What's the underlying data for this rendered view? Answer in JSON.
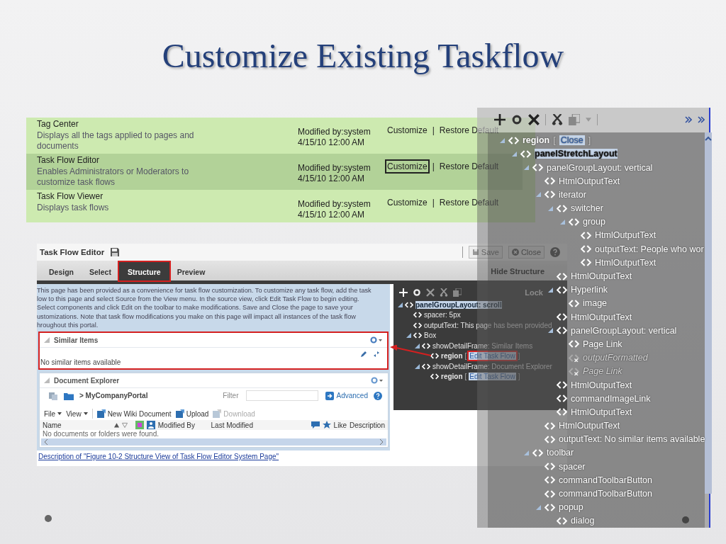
{
  "slide_title": "Customize Existing Taskflow",
  "taskflows": [
    {
      "name": "Tag Center",
      "description": "Displays all the tags applied to pages and documents",
      "modified_by": "Modified by:system",
      "modified": "4/15/10 12:00 AM",
      "customize": "Customize",
      "separator": "|",
      "restore": "Restore Default",
      "selected": false
    },
    {
      "name": "Task Flow Editor",
      "description": "Enables Administrators or Moderators to customize task flows",
      "modified_by": "Modified by:system",
      "modified": "4/15/10 12:00 AM",
      "customize": "Customize",
      "separator": "|",
      "restore": "Restore Default",
      "selected": true
    },
    {
      "name": "Task Flow Viewer",
      "description": "Displays task flows",
      "modified_by": "Modified by:system",
      "modified": "4/15/10 12:00 AM",
      "customize": "Customize",
      "separator": "|",
      "restore": "Restore Default",
      "selected": false
    }
  ],
  "editor": {
    "title": "Task Flow Editor",
    "save": "Save",
    "close": "Close",
    "tabs": [
      {
        "label": "Design",
        "selected": false
      },
      {
        "label": "Select",
        "selected": false
      },
      {
        "label": "Structure",
        "selected": true
      },
      {
        "label": "Preview",
        "selected": false
      }
    ],
    "hide_structure": "Hide Structure",
    "lock": "Lock",
    "info_lines": [
      "This page has been provided as a convenience for task flow customization. To customize any task flow, add the task",
      "low to this page and select Source from the View menu. In the source view, click Edit Task Flow to begin editing.",
      "Select components and click Edit on the toolbar to make modifications. Save and Close the page to save your",
      "ustomizations. Note that task flow modifications you make on this page will impact all instances of the task flow",
      "hroughout this portal."
    ],
    "similar_items": {
      "title": "Similar Items",
      "empty": "No similar items available"
    },
    "document_explorer": {
      "title": "Document Explorer",
      "path": "> MyCompanyPortal",
      "filter_label": "Filter",
      "advanced": "Advanced",
      "menus": [
        "File",
        "View"
      ],
      "actions": [
        {
          "label": "New Wiki Document",
          "disabled": false
        },
        {
          "label": "Upload",
          "disabled": false
        },
        {
          "label": "Download",
          "disabled": true
        }
      ],
      "columns": [
        "Name",
        "Modified By",
        "Last Modified",
        "Like",
        "Description"
      ],
      "empty": "No documents or folders were found."
    }
  },
  "caption_link": "Description of \"Figure 10-2 Structure View of Task Flow Editor System Page\"",
  "structure_tree": [
    {
      "label": "panelGroupLayout: scroll",
      "selected": true,
      "disabled": false,
      "children": [
        {
          "label": "spacer: 5px",
          "selected": false,
          "disabled": false
        },
        {
          "label": "outputText: This page has been provided",
          "selected": false,
          "disabled": false
        },
        {
          "label": "Box",
          "selected": false,
          "disabled": false,
          "children": [
            {
              "label": "showDetailFrame: Similar Items",
              "selected": false,
              "disabled": false,
              "children": [
                {
                  "label": "region",
                  "selected": false,
                  "disabled": false,
                  "action": {
                    "open": "[",
                    "label": "Edit Task Flow",
                    "close": "]",
                    "outlined": true
                  }
                }
              ]
            },
            {
              "label": "showDetailFrame: Document Explorer",
              "selected": false,
              "disabled": false,
              "children": [
                {
                  "label": "region",
                  "selected": false,
                  "disabled": false,
                  "action": {
                    "open": "[",
                    "label": "Edit Task Flow",
                    "close": "]",
                    "outlined": false
                  }
                }
              ]
            }
          ]
        }
      ]
    }
  ],
  "overlay_tree": [
    {
      "label": "region",
      "selected": false,
      "disabled": false,
      "action": {
        "open": "[",
        "label": "Close",
        "close": "]",
        "outlined": false
      },
      "children": [
        {
          "label": "panelStretchLayout",
          "selected": true,
          "disabled": false,
          "children": [
            {
              "label": "panelGroupLayout: vertical",
              "selected": false,
              "disabled": false,
              "children": [
                {
                  "label": "HtmlOutputText",
                  "selected": false,
                  "disabled": false
                },
                {
                  "label": "iterator",
                  "selected": false,
                  "disabled": false,
                  "children": [
                    {
                      "label": "switcher",
                      "selected": false,
                      "disabled": false,
                      "children": [
                        {
                          "label": "group",
                          "selected": false,
                          "disabled": false,
                          "children": [
                            {
                              "label": "HtmlOutputText",
                              "selected": false,
                              "disabled": false
                            },
                            {
                              "label": "outputText: People who wor",
                              "selected": false,
                              "disabled": false
                            },
                            {
                              "label": "HtmlOutputText",
                              "selected": false,
                              "disabled": false
                            }
                          ]
                        }
                      ]
                    },
                    {
                      "label": "HtmlOutputText",
                      "selected": false,
                      "disabled": false
                    },
                    {
                      "label": "Hyperlink",
                      "selected": false,
                      "disabled": false,
                      "children": [
                        {
                          "label": "image",
                          "selected": false,
                          "disabled": false
                        }
                      ]
                    },
                    {
                      "label": "HtmlOutputText",
                      "selected": false,
                      "disabled": false
                    },
                    {
                      "label": "panelGroupLayout: vertical",
                      "selected": false,
                      "disabled": false,
                      "children": [
                        {
                          "label": "Page Link",
                          "selected": false,
                          "disabled": false
                        },
                        {
                          "label": "outputFormatted",
                          "selected": false,
                          "disabled": true
                        },
                        {
                          "label": "Page Link",
                          "selected": false,
                          "disabled": true
                        }
                      ]
                    },
                    {
                      "label": "HtmlOutputText",
                      "selected": false,
                      "disabled": false
                    },
                    {
                      "label": "commandImageLink",
                      "selected": false,
                      "disabled": false
                    },
                    {
                      "label": "HtmlOutputText",
                      "selected": false,
                      "disabled": false
                    }
                  ]
                },
                {
                  "label": "HtmlOutputText",
                  "selected": false,
                  "disabled": false
                },
                {
                  "label": "outputText: No similar items available",
                  "selected": false,
                  "disabled": false
                }
              ]
            },
            {
              "label": "toolbar",
              "selected": false,
              "disabled": false,
              "children": [
                {
                  "label": "spacer",
                  "selected": false,
                  "disabled": false
                },
                {
                  "label": "commandToolbarButton",
                  "selected": false,
                  "disabled": false
                },
                {
                  "label": "commandToolbarButton",
                  "selected": false,
                  "disabled": false
                },
                {
                  "label": "popup",
                  "selected": false,
                  "disabled": false,
                  "children": [
                    {
                      "label": "dialog",
                      "selected": false,
                      "disabled": false
                    }
                  ]
                }
              ]
            }
          ]
        }
      ]
    }
  ]
}
